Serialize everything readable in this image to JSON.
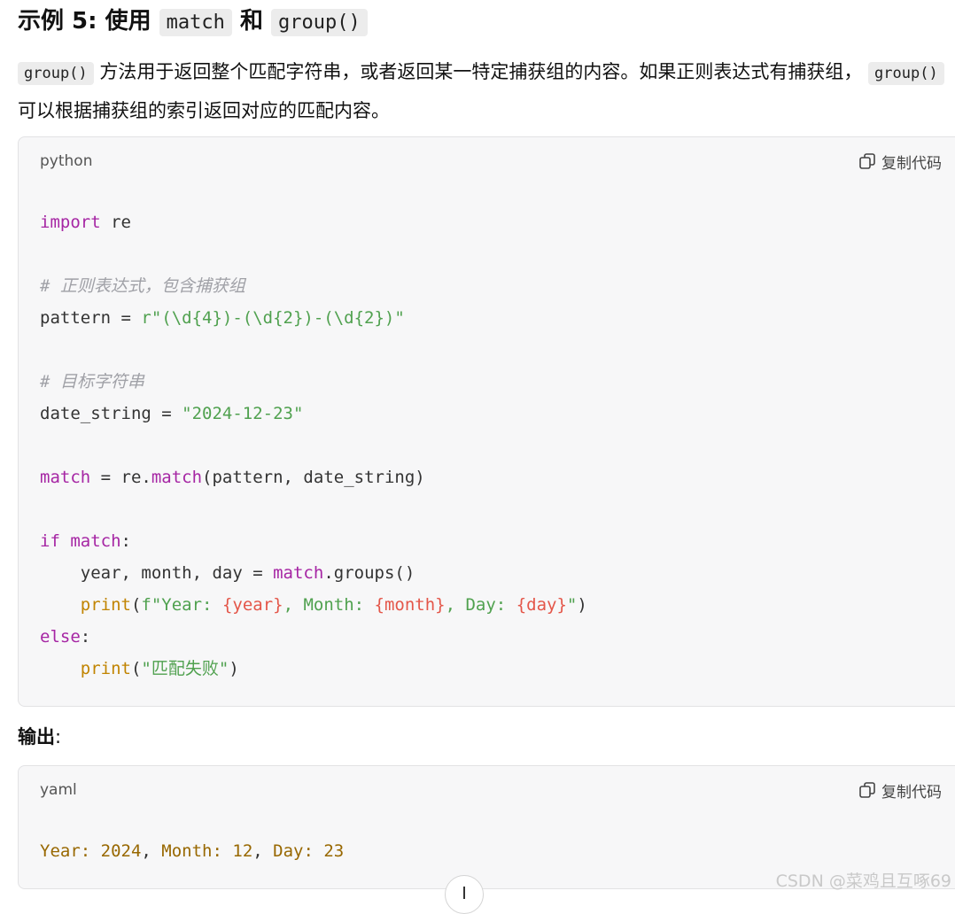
{
  "heading": {
    "prefix": "示例 5: 使用",
    "code1": "match",
    "conj": "和",
    "code2": "group()"
  },
  "description": {
    "code1": "group()",
    "text1": "方法用于返回整个匹配字符串，或者返回某一特定捕获组的内容。如果正则表达式有捕获组，",
    "code2": "group()",
    "text2": "可以根据捕获组的索引返回对应的匹配内容。"
  },
  "code_block": {
    "language": "python",
    "copy_label": "复制代码",
    "tokens": {
      "t1": "import",
      "t2": " re",
      "t3": "# 正则表达式，包含捕获组",
      "t4": "pattern = ",
      "t5": "r\"(\\d{4})-(\\d{2})-(\\d{2})\"",
      "t6": "# 目标字符串",
      "t7": "date_string = ",
      "t8": "\"2024-12-23\"",
      "t9": "match",
      "t10": " = re.",
      "t11": "match",
      "t12": "(pattern, date_string)",
      "t13": "if",
      "t14": " ",
      "t15": "match",
      "t16": ":",
      "t17": "    year, month, day = ",
      "t18": "match",
      "t19": ".groups()",
      "t20": "    ",
      "t21": "print",
      "t22": "(",
      "t23": "f\"Year: ",
      "t24": "{year}",
      "t25": ", Month: ",
      "t26": "{month}",
      "t27": ", Day: ",
      "t28": "{day}",
      "t29": "\"",
      "t30": ")",
      "t31": "else",
      "t32": ":",
      "t33": "    ",
      "t34": "print",
      "t35": "(",
      "t36": "\"匹配失败\"",
      "t37": ")"
    }
  },
  "output_label": "输出",
  "output_colon": ":",
  "output_block": {
    "language": "yaml",
    "copy_label": "复制代码",
    "tokens": {
      "o1": "Year:",
      "o2": " 2024",
      "o3": ",",
      "o4": " Month:",
      "o5": " 12",
      "o6": ",",
      "o7": " Day:",
      "o8": " 23"
    }
  },
  "watermark": "CSDN @菜鸡且互啄69",
  "icons": [
    "copy-icon",
    "scroll-down-icon"
  ],
  "colors": {
    "keyword": "#a626a4",
    "string": "#50a14f",
    "comment": "#a0a1a7",
    "builtin": "#c18401",
    "substitution": "#e45649",
    "yaml_value": "#986801",
    "code_bg": "#f7f7f8"
  }
}
